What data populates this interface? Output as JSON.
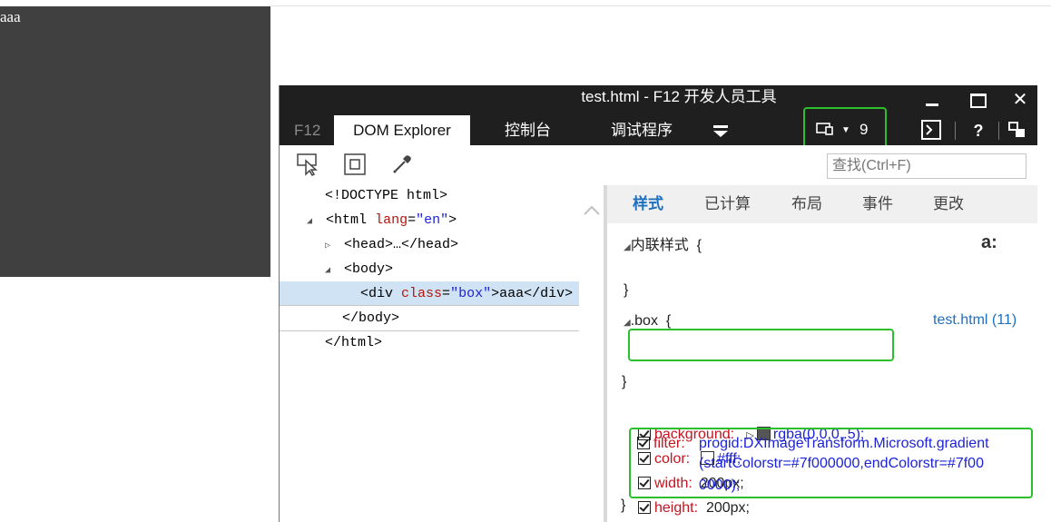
{
  "page": {
    "box_text": "aaa"
  },
  "devtools": {
    "title": "test.html - F12 开发人员工具",
    "tabs": {
      "f12": "F12",
      "dom": "DOM Explorer",
      "console": "控制台",
      "debugger": "调试程序"
    },
    "emulation_count": "9",
    "search_placeholder": "查找(Ctrl+F)"
  },
  "dom_tree": {
    "doctype": "<!DOCTYPE html>",
    "html_tag": "html",
    "html_attr": "lang",
    "html_val": "\"en\"",
    "head": "<head>…</head>",
    "body_open": "<body>",
    "div_tag": "<div",
    "div_attr": "class",
    "div_val": "\"box\"",
    "div_rest": ">aaa</div>",
    "body_close": "</body>",
    "html_close": "</html>"
  },
  "styles": {
    "tabs": [
      "样式",
      "已计算",
      "布局",
      "事件",
      "更改"
    ],
    "inline_header": "内联样式",
    "open_brace": "{",
    "close_brace": "}",
    "selector": ".box",
    "source_link": "test.html (11)",
    "font_icon": "a:",
    "properties": [
      {
        "name": "background:",
        "value": "rgba(0,0,0,.5);",
        "swatch": "#555555"
      },
      {
        "name": "color:",
        "value": "#fff;",
        "swatch": "#ffffff"
      },
      {
        "name": "width:",
        "value": "200px;"
      },
      {
        "name": "height:",
        "value": "200px;"
      },
      {
        "name": "filter:",
        "value_lines": [
          "progid:DXImageTransform.Microsoft.gradient",
          "(startColorstr=#7f000000,endColorstr=#7f00",
          "0000);"
        ]
      }
    ]
  },
  "colors": {
    "highlight": "#2bbf2b",
    "titlebar": "#1f1f1f",
    "accent": "#1e6fbf"
  },
  "icons": [
    "select-element-icon",
    "highlight-box-icon",
    "color-picker-icon",
    "emulation-icon",
    "console-icon",
    "help-icon",
    "undock-icon"
  ]
}
